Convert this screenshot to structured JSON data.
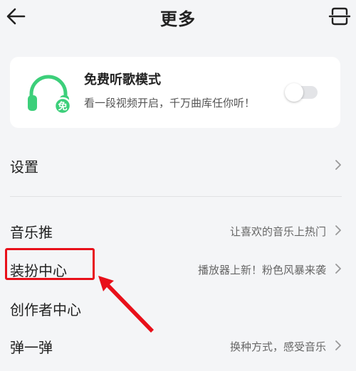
{
  "header": {
    "title": "更多"
  },
  "free_mode": {
    "title": "免费听歌模式",
    "subtitle": "看一段视频开启，千万曲库任你听！",
    "badge": "免",
    "enabled": false
  },
  "menu": {
    "settings": {
      "label": "设置"
    },
    "music_push": {
      "label": "音乐推",
      "hint": "让喜欢的音乐上热门"
    },
    "dress_center": {
      "label": "装扮中心",
      "hint": "播放器上新！粉色风暴来袭"
    },
    "creator_center": {
      "label": "创作者中心"
    },
    "pop": {
      "label": "弹一弹",
      "hint": "换种方式，感受音乐"
    }
  },
  "colors": {
    "accent_green": "#3ccf7a",
    "annotation_red": "#e8101a"
  }
}
